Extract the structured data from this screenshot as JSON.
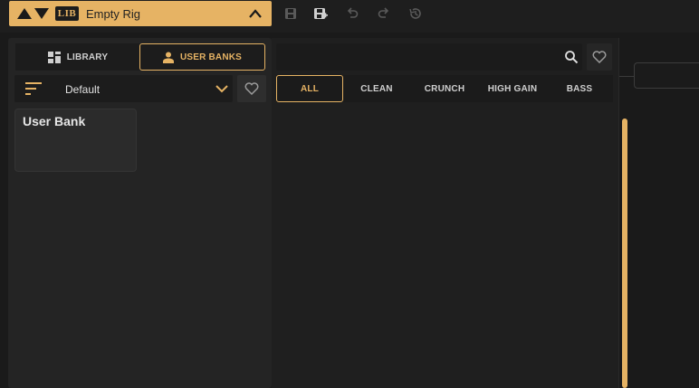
{
  "topbar": {
    "rig_name": "Empty Rig",
    "lib_badge": "LIB",
    "tools": [
      "save-icon",
      "save-as-icon",
      "undo-icon",
      "redo-icon",
      "history-icon"
    ]
  },
  "left_panel": {
    "tabs": [
      {
        "label": "LIBRARY",
        "icon": "grid-icon",
        "active": false
      },
      {
        "label": "USER BANKS",
        "icon": "user-icon",
        "active": true
      }
    ],
    "sort": {
      "value": "Default"
    },
    "banks": [
      {
        "label": "User Bank"
      }
    ]
  },
  "main_panel": {
    "search": {
      "placeholder": ""
    },
    "filters": [
      {
        "label": "ALL",
        "active": true
      },
      {
        "label": "CLEAN",
        "active": false
      },
      {
        "label": "CRUNCH",
        "active": false
      },
      {
        "label": "HIGH GAIN",
        "active": false
      },
      {
        "label": "BASS",
        "active": false
      }
    ]
  },
  "colors": {
    "accent": "#e6b364",
    "background": "#1a1a1a",
    "panel": "#242424"
  }
}
